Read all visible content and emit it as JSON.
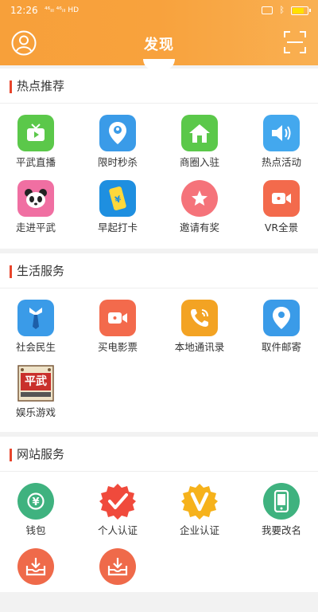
{
  "status_bar": {
    "time": "12:26",
    "signal": "⁴⁶ᵢₗₗ ⁴⁶ᵢₗₗ HD"
  },
  "header": {
    "title": "发现"
  },
  "sections": {
    "hot": {
      "title": "热点推荐",
      "items": [
        {
          "label": "平武直播",
          "icon": "tv-icon",
          "color": "#5bc84a"
        },
        {
          "label": "限时秒杀",
          "icon": "location-pin-icon",
          "color": "#3a9be8"
        },
        {
          "label": "商圈入驻",
          "icon": "house-icon",
          "color": "#5bc84a"
        },
        {
          "label": "热点活动",
          "icon": "speaker-icon",
          "color": "#43a8ee"
        },
        {
          "label": "走进平武",
          "icon": "panda-icon",
          "color": "#f06fa2"
        },
        {
          "label": "早起打卡",
          "icon": "phone-yen-icon",
          "color": "#1e8fe0"
        },
        {
          "label": "邀请有奖",
          "icon": "star-bubble-icon",
          "color": "#f5737a"
        },
        {
          "label": "VR全景",
          "icon": "video-camera-icon",
          "color": "#f36a4c"
        }
      ]
    },
    "life": {
      "title": "生活服务",
      "items": [
        {
          "label": "社会民生",
          "icon": "tie-icon",
          "color": "#3a9be8"
        },
        {
          "label": "买电影票",
          "icon": "video-camera-icon",
          "color": "#f36a4c"
        },
        {
          "label": "本地通讯录",
          "icon": "phone-icon",
          "color": "#f3a323"
        },
        {
          "label": "取件邮寄",
          "icon": "location-pin-icon",
          "color": "#3a9be8"
        },
        {
          "label": "娱乐游戏",
          "icon": "game-logo-icon",
          "color": "#c9302c",
          "logo_text": "平武"
        }
      ]
    },
    "web": {
      "title": "网站服务",
      "items": [
        {
          "label": "钱包",
          "icon": "wallet-yen-icon",
          "color": "#3fb27f"
        },
        {
          "label": "个人认证",
          "icon": "check-badge-icon",
          "color": "#f04a3c"
        },
        {
          "label": "企业认证",
          "icon": "v-badge-icon",
          "color": "#f6b21b"
        },
        {
          "label": "我要改名",
          "icon": "mobile-icon",
          "color": "#3fb27f"
        },
        {
          "label": "",
          "icon": "download-tray-icon",
          "color": "#ef6a4a"
        },
        {
          "label": "",
          "icon": "download-tray-icon",
          "color": "#ef6a4a"
        }
      ]
    }
  }
}
